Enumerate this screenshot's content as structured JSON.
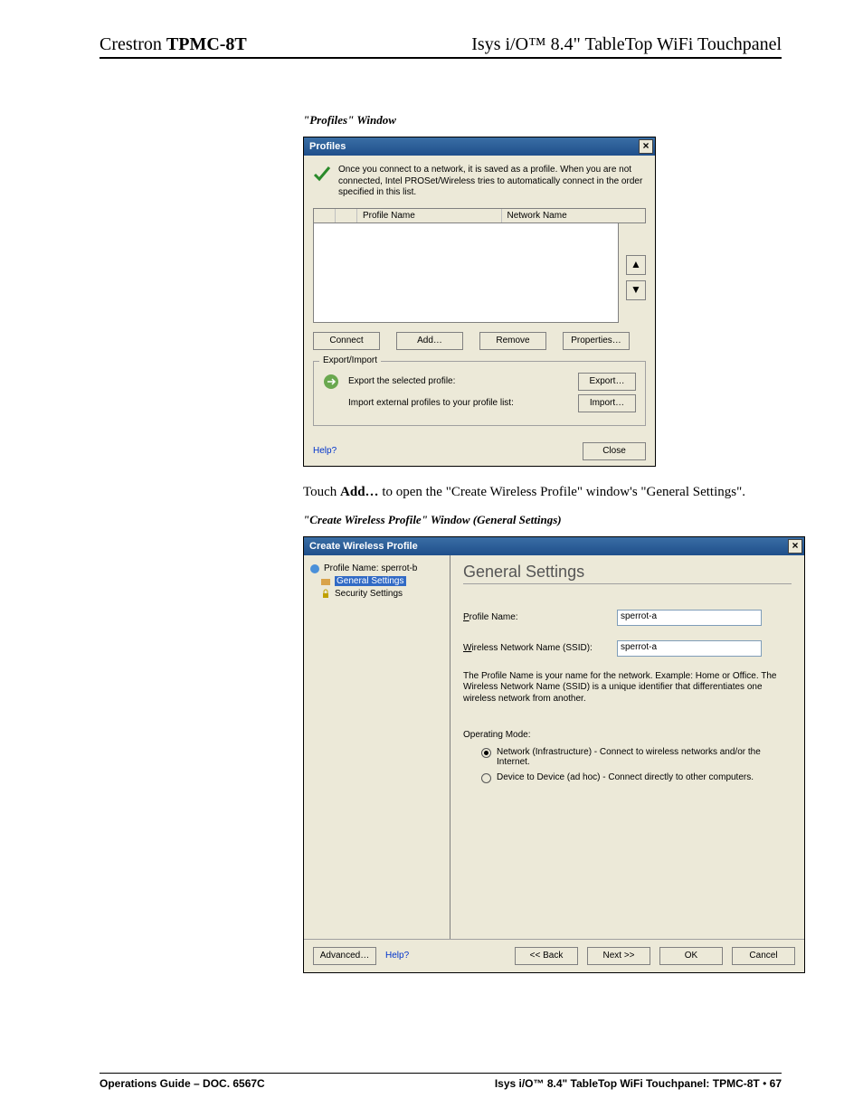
{
  "header": {
    "left_a": "Crestron ",
    "left_b": "TPMC-8T",
    "right": "Isys i/O™ 8.4\" TableTop WiFi Touchpanel"
  },
  "caption1": "\"Profiles\" Window",
  "profiles": {
    "title": "Profiles",
    "intro": "Once you connect to a network, it is saved as a profile. When you are not connected, Intel PROSet/Wireless tries to automatically connect in the order specified in this list.",
    "col_profile": "Profile Name",
    "col_network": "Network Name",
    "btn_connect": "Connect",
    "btn_add": "Add…",
    "btn_remove": "Remove",
    "btn_properties": "Properties…",
    "legend": "Export/Import",
    "export_label": "Export the selected profile:",
    "import_label": "Import external profiles to your profile list:",
    "btn_export": "Export…",
    "btn_import": "Import…",
    "help": "Help?",
    "btn_close": "Close"
  },
  "body_line_pre": "Touch ",
  "body_line_bold": "Add…",
  "body_line_post": " to open the \"Create Wireless Profile\" window's \"General Settings\".",
  "caption2": "\"Create Wireless Profile\" Window (General Settings)",
  "cwp": {
    "title": "Create Wireless Profile",
    "nav_profile": "Profile Name: sperrot-b",
    "nav_general": "General Settings",
    "nav_security": "Security Settings",
    "heading": "General Settings",
    "lbl_profile": "Profile Name:",
    "val_profile": "sperrot-a",
    "lbl_ssid": "Wireless Network Name (SSID):",
    "val_ssid": "sperrot-a",
    "desc": "The Profile Name is your name for the network. Example: Home or Office. The Wireless Network Name (SSID) is a unique identifier that differentiates one wireless network from another.",
    "lbl_mode": "Operating Mode:",
    "radio1": "Network (Infrastructure) - Connect to wireless networks and/or the Internet.",
    "radio2": "Device to Device (ad hoc) - Connect directly to other computers.",
    "btn_advanced": "Advanced…",
    "help": "Help?",
    "btn_back": "<< Back",
    "btn_next": "Next >>",
    "btn_ok": "OK",
    "btn_cancel": "Cancel"
  },
  "footer": {
    "left": "Operations Guide – DOC. 6567C",
    "right_a": "Isys i/O™ 8.4\" TableTop WiFi Touchpanel: TPMC-8T",
    "bullet": " • ",
    "page": "67"
  }
}
